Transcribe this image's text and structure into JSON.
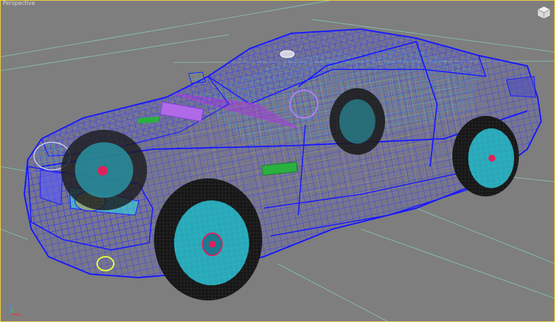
{
  "viewport": {
    "label": "Perspective",
    "background_color": "#7e7e7e",
    "active_border_color": "#f2d23a",
    "render_mode": "wireframe"
  },
  "scene": {
    "object": "car-wireframe-model",
    "colors": {
      "grid": "#8ad8c8",
      "body_wire": "#1a1aff",
      "interior_wire": "#29d8e0",
      "frame_wire": "#e0c040",
      "accent_wire": "#b040e0",
      "side_marker": "#2ab040",
      "rim": "#2aa8b8",
      "tire": "#1a1a1a",
      "hub": "#e0205a"
    }
  },
  "viewcube": {
    "icon": "home-viewcube-icon"
  },
  "axis_tripod": {
    "icon": "xyz-axis-icon",
    "x_color": "#e04040",
    "y_color": "#40c040",
    "z_color": "#4a8aff"
  }
}
